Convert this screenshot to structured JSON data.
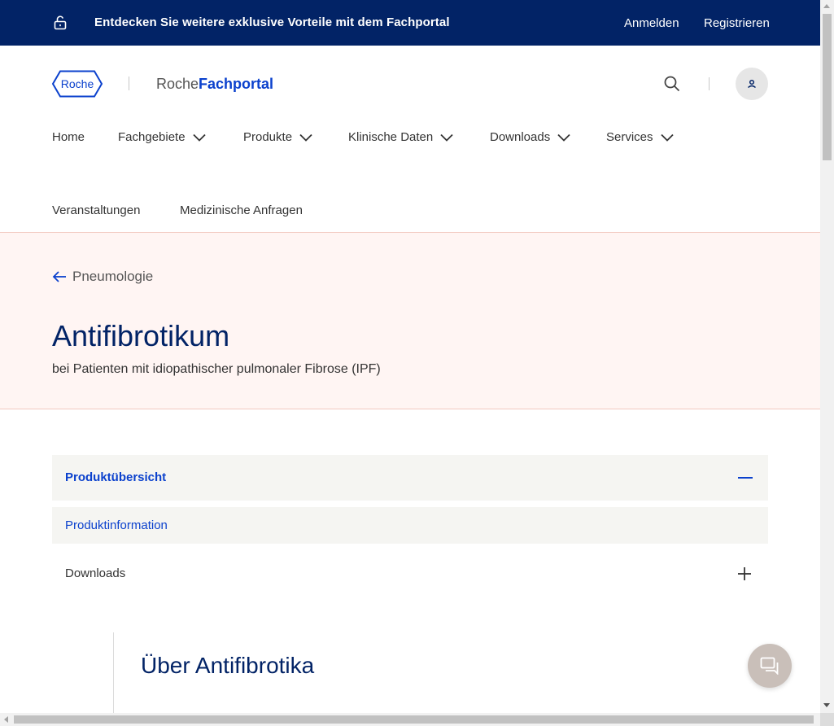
{
  "topbar": {
    "promo_text": "Entdecken Sie weitere exklusive Vorteile mit dem Fachportal",
    "login_label": "Anmelden",
    "register_label": "Registrieren"
  },
  "header": {
    "logo_text": "Roche",
    "portal_prefix": "Roche",
    "portal_brand": "Fachportal"
  },
  "nav": {
    "items": [
      {
        "label": "Home"
      },
      {
        "label": "Fachgebiete"
      },
      {
        "label": "Produkte"
      },
      {
        "label": "Klinische Daten"
      },
      {
        "label": "Downloads"
      },
      {
        "label": "Services"
      },
      {
        "label": "Veranstaltungen"
      },
      {
        "label": "Medizinische Anfragen"
      }
    ]
  },
  "hero": {
    "back_label": "Pneumologie",
    "title": "Antifibrotikum",
    "subtitle": "bei Patienten mit idiopathischer pulmonaler Fibrose (IPF)"
  },
  "accordion": {
    "overview_label": "Produktübersicht",
    "info_label": "Produktinformation",
    "downloads_label": "Downloads"
  },
  "content": {
    "section_title": "Über Antifibrotika"
  },
  "colors": {
    "topbar": "#022366",
    "accent": "#0b41cd",
    "hero_bg": "#fff5f3",
    "accordion_bg": "#f5f5f2",
    "chat_button": "#c9bfb9"
  }
}
